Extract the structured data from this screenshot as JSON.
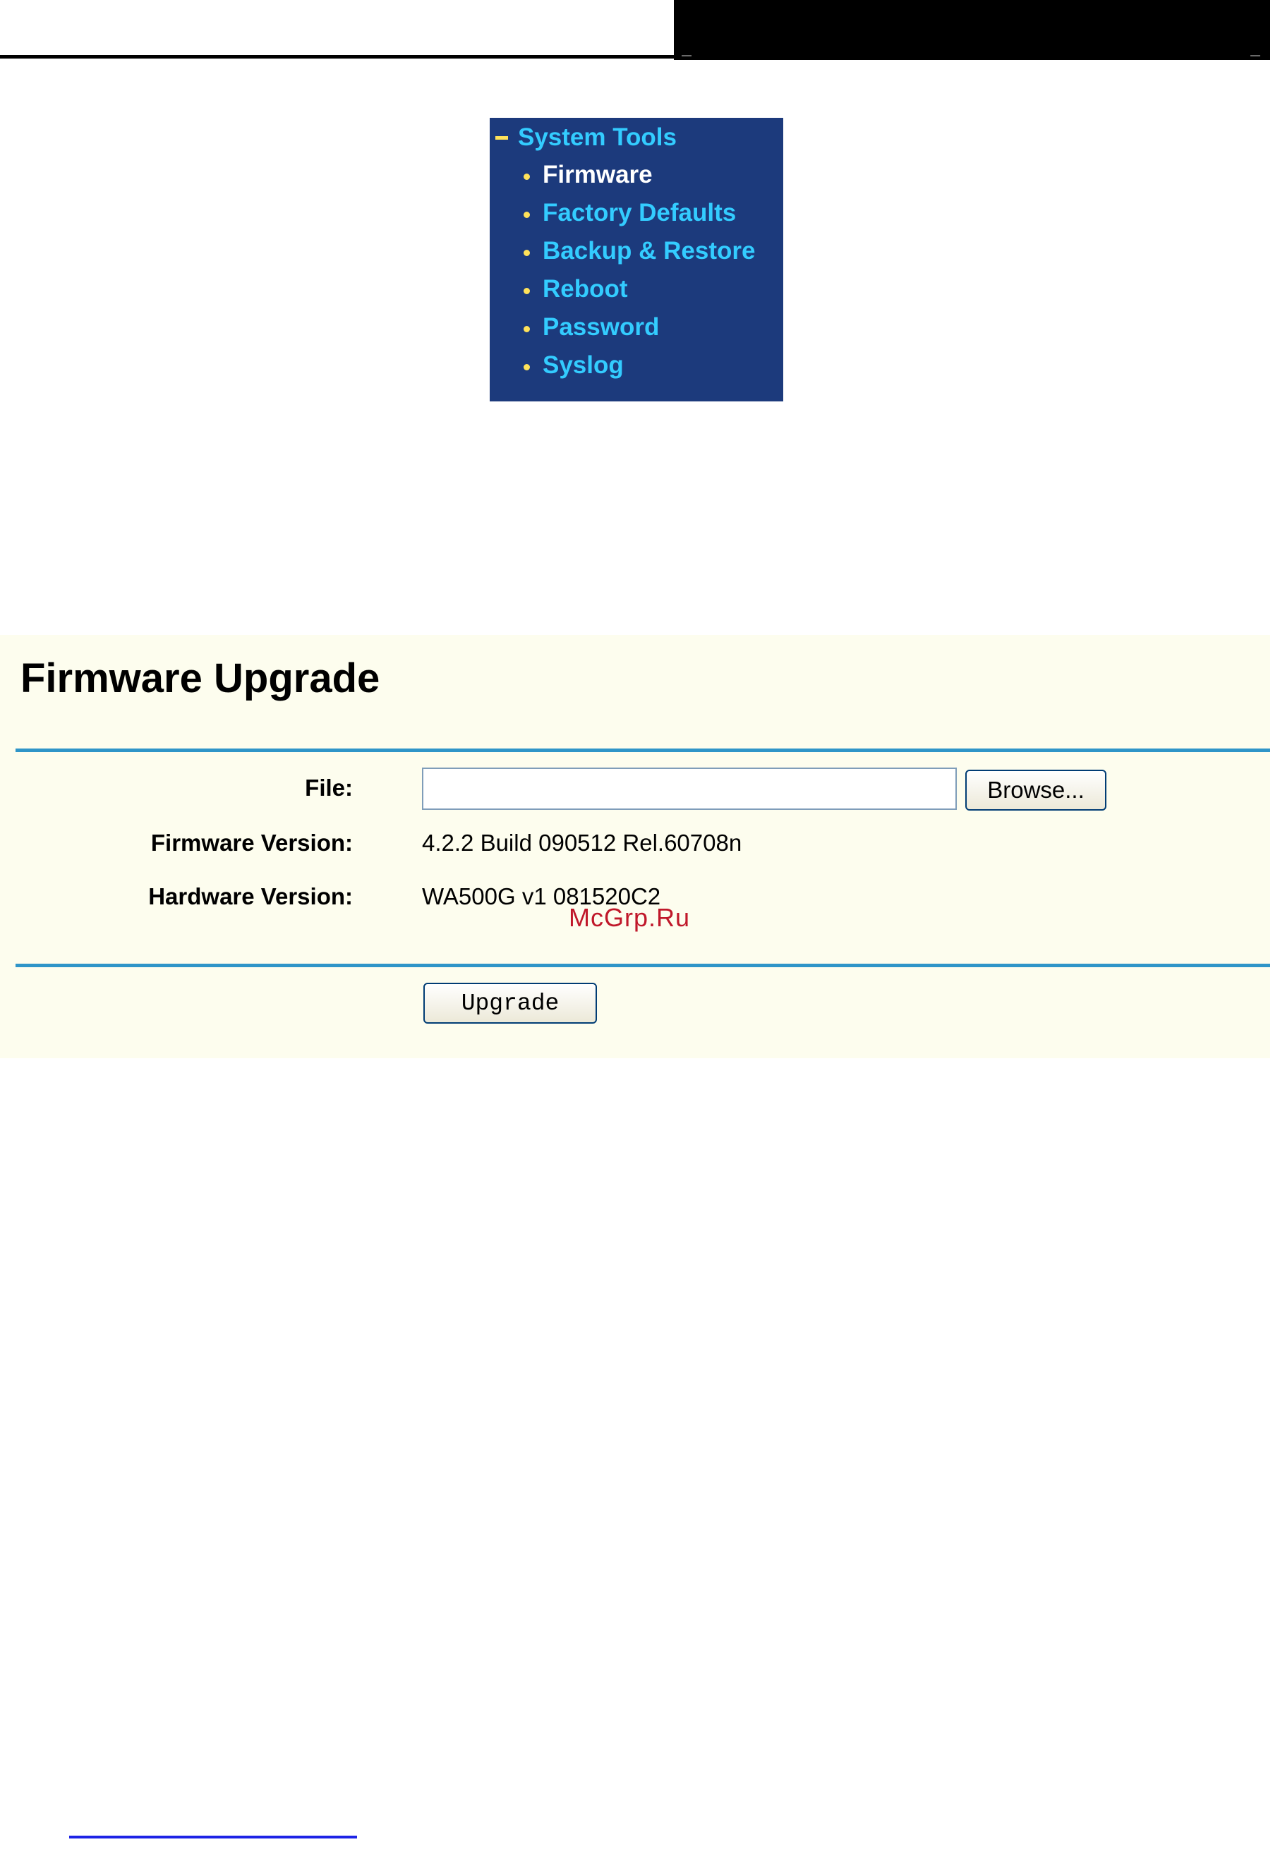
{
  "nav": {
    "header": "System Tools",
    "items": [
      {
        "label": "Firmware",
        "active": true
      },
      {
        "label": "Factory Defaults",
        "active": false
      },
      {
        "label": "Backup & Restore",
        "active": false
      },
      {
        "label": "Reboot",
        "active": false
      },
      {
        "label": "Password",
        "active": false
      },
      {
        "label": "Syslog",
        "active": false
      }
    ]
  },
  "firmware_upgrade": {
    "title": "Firmware Upgrade",
    "file_label": "File:",
    "file_value": "",
    "browse_label": "Browse...",
    "firmware_version_label": "Firmware Version:",
    "firmware_version_value": "4.2.2 Build 090512 Rel.60708n",
    "hardware_version_label": "Hardware Version:",
    "hardware_version_value": "WA500G v1 081520C2",
    "upgrade_label": "Upgrade"
  },
  "watermark": "McGrp.Ru",
  "colors": {
    "nav_background": "#1c3a7c",
    "nav_link": "#33ccff",
    "nav_active": "#ffffff",
    "nav_bullet": "#ffe25a",
    "panel_background": "#fdfdee",
    "panel_rule": "#2f95c8",
    "watermark": "#c0182a"
  }
}
